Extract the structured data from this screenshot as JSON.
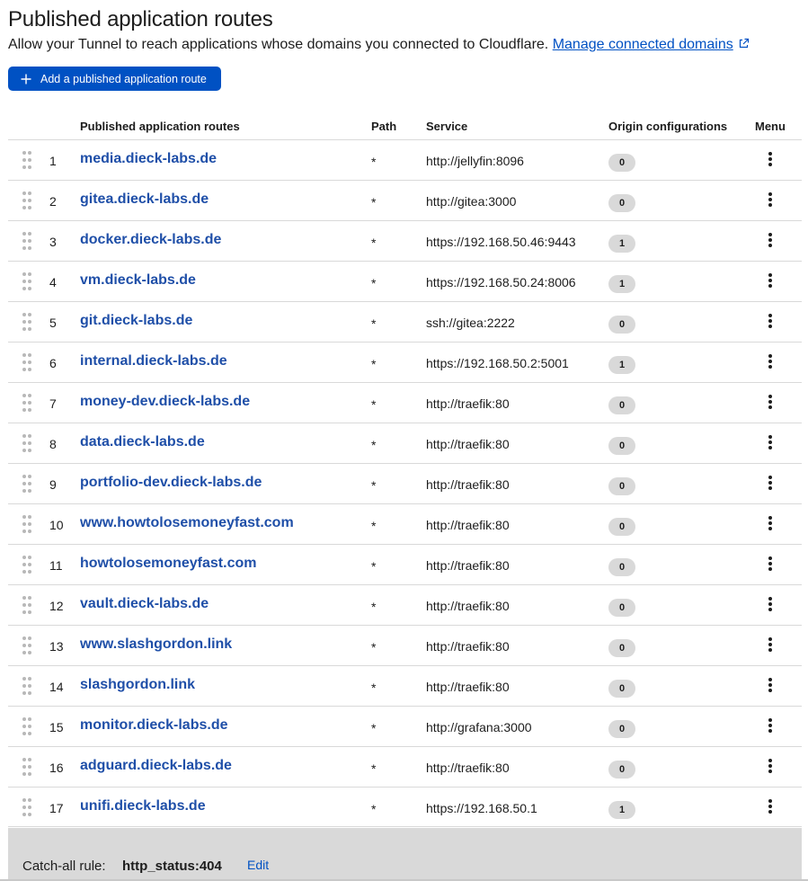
{
  "header": {
    "title": "Published application routes",
    "description": "Allow your Tunnel to reach applications whose domains you connected to Cloudflare.",
    "manage_link": "Manage connected domains",
    "add_button": "Add a published application route"
  },
  "table": {
    "columns": {
      "routes": "Published application routes",
      "path": "Path",
      "service": "Service",
      "origin": "Origin configurations",
      "menu": "Menu"
    },
    "rows": [
      {
        "n": "1",
        "host": "media.dieck-labs.de",
        "path": "*",
        "service": "http://jellyfin:8096",
        "origin": "0"
      },
      {
        "n": "2",
        "host": "gitea.dieck-labs.de",
        "path": "*",
        "service": "http://gitea:3000",
        "origin": "0"
      },
      {
        "n": "3",
        "host": "docker.dieck-labs.de",
        "path": "*",
        "service": "https://192.168.50.46:9443",
        "origin": "1"
      },
      {
        "n": "4",
        "host": "vm.dieck-labs.de",
        "path": "*",
        "service": "https://192.168.50.24:8006",
        "origin": "1"
      },
      {
        "n": "5",
        "host": "git.dieck-labs.de",
        "path": "*",
        "service": "ssh://gitea:2222",
        "origin": "0"
      },
      {
        "n": "6",
        "host": "internal.dieck-labs.de",
        "path": "*",
        "service": "https://192.168.50.2:5001",
        "origin": "1"
      },
      {
        "n": "7",
        "host": "money-dev.dieck-labs.de",
        "path": "*",
        "service": "http://traefik:80",
        "origin": "0"
      },
      {
        "n": "8",
        "host": "data.dieck-labs.de",
        "path": "*",
        "service": "http://traefik:80",
        "origin": "0"
      },
      {
        "n": "9",
        "host": "portfolio-dev.dieck-labs.de",
        "path": "*",
        "service": "http://traefik:80",
        "origin": "0"
      },
      {
        "n": "10",
        "host": "www.howtolosemoneyfast.com",
        "path": "*",
        "service": "http://traefik:80",
        "origin": "0"
      },
      {
        "n": "11",
        "host": "howtolosemoneyfast.com",
        "path": "*",
        "service": "http://traefik:80",
        "origin": "0"
      },
      {
        "n": "12",
        "host": "vault.dieck-labs.de",
        "path": "*",
        "service": "http://traefik:80",
        "origin": "0"
      },
      {
        "n": "13",
        "host": "www.slashgordon.link",
        "path": "*",
        "service": "http://traefik:80",
        "origin": "0"
      },
      {
        "n": "14",
        "host": "slashgordon.link",
        "path": "*",
        "service": "http://traefik:80",
        "origin": "0"
      },
      {
        "n": "15",
        "host": "monitor.dieck-labs.de",
        "path": "*",
        "service": "http://grafana:3000",
        "origin": "0"
      },
      {
        "n": "16",
        "host": "adguard.dieck-labs.de",
        "path": "*",
        "service": "http://traefik:80",
        "origin": "0"
      },
      {
        "n": "17",
        "host": "unifi.dieck-labs.de",
        "path": "*",
        "service": "https://192.168.50.1",
        "origin": "1"
      }
    ]
  },
  "catch_all": {
    "label": "Catch-all rule:",
    "value": "http_status:404",
    "edit": "Edit"
  },
  "icons": {
    "add": "plus-icon",
    "external_link": "external-link-icon",
    "drag": "drag-handle-icon",
    "menu": "kebab-menu-icon"
  },
  "colors": {
    "accent": "#0051c3",
    "link": "#1f4fa8",
    "badge_bg": "#d9d9d9",
    "footer_bg": "#d9d9d9"
  }
}
